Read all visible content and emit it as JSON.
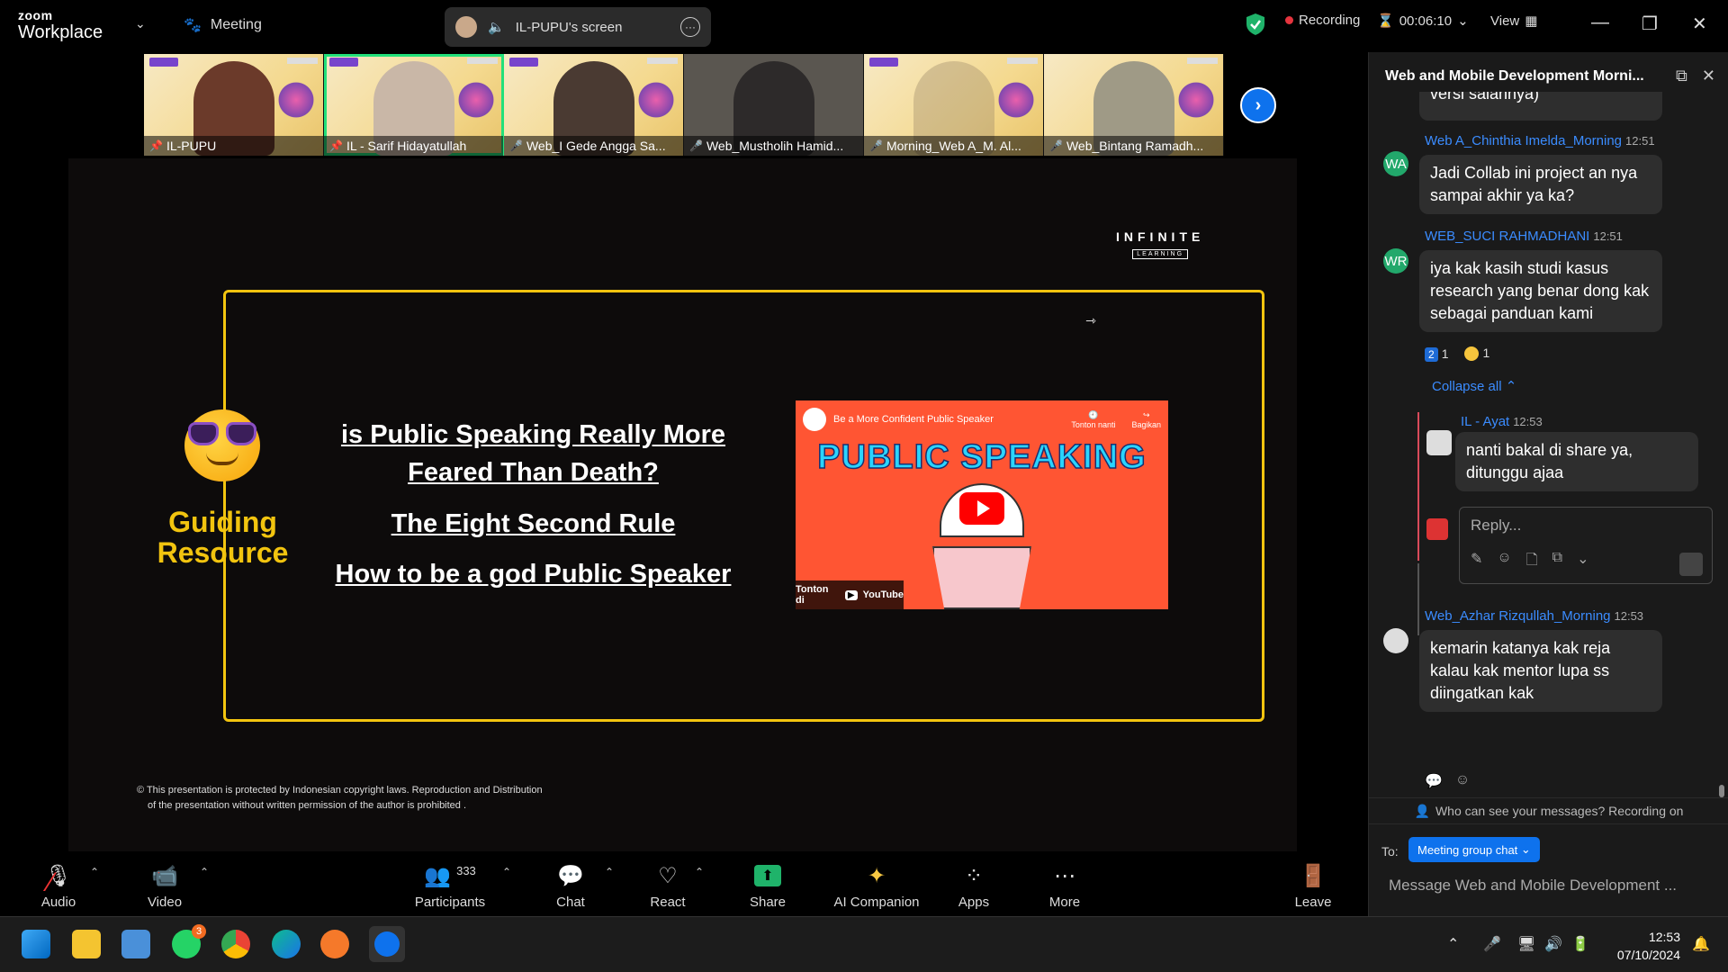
{
  "topbar": {
    "brand_small": "zoom",
    "brand_big": "Workplace",
    "meeting_label": "Meeting",
    "screen_label": "IL-PUPU's screen",
    "recording_label": "Recording",
    "timer": "00:06:10",
    "view_label": "View"
  },
  "gallery": {
    "participants": [
      {
        "name": "IL-PUPU",
        "skin": "#6b3a2a"
      },
      {
        "name": "IL - Sarif Hidayatullah",
        "skin": "#c9b7a7"
      },
      {
        "name": "Web_I Gede Angga Sa...",
        "skin": "#4a3a32"
      },
      {
        "name": "Web_Mustholih Hamid...",
        "skin": "#2d2a2a"
      },
      {
        "name": "Morning_Web A_M. Al...",
        "skin": "#a08c6b"
      },
      {
        "name": "Web_Bintang Ramadh...",
        "skin": "#9f9a86"
      }
    ]
  },
  "slide": {
    "brand": "INFINITE",
    "brand_sub": "LEARNING",
    "guiding": "Guiding Resource",
    "link1": "is Public Speaking Really More Feared Than Death?",
    "link2": "The Eight Second Rule",
    "link3": "How to be a god Public Speaker",
    "video_title": "Be a More Confident Public Speaker",
    "video_watch_later": "Tonton nanti",
    "video_share": "Bagikan",
    "video_big": "PUBLIC SPEAKING",
    "video_watch_on": "Tonton di",
    "video_yt": "YouTube",
    "copyright_1": "© This presentation is protected by Indonesian copyright laws. Reproduction and Distribution",
    "copyright_2": "of the presentation without written permission of the author is prohibited ."
  },
  "chat": {
    "title": "Web and Mobile Development Morni...",
    "partial_msg": "versi salahnya)",
    "messages": [
      {
        "name": "Web A_Chinthia Imelda_Morning",
        "time": "12:51",
        "initials": "WA",
        "text": "Jadi Collab ini project an nya sampai akhir ya ka?"
      },
      {
        "name": "WEB_SUCI RAHMADHANI",
        "time": "12:51",
        "initials": "WR",
        "text": "iya kak kasih studi kasus research yang benar dong kak sebagai panduan kami"
      },
      {
        "name": "IL - Ayat",
        "time": "12:53",
        "text": "nanti bakal di share ya, ditunggu ajaa"
      },
      {
        "name": "Web_Azhar Rizqullah_Morning",
        "time": "12:53",
        "text": "kemarin katanya kak reja kalau kak mentor lupa ss diingatkan kak"
      }
    ],
    "reaction1_count": "1",
    "reaction1_badge": "2",
    "reaction2_count": "1",
    "collapse_label": "Collapse all",
    "reply_placeholder": "Reply...",
    "who_label": "Who can see your messages? Recording on",
    "to_label": "To:",
    "to_value": "Meeting group chat",
    "message_placeholder": "Message Web and Mobile Development ..."
  },
  "toolbar": {
    "audio": "Audio",
    "video": "Video",
    "participants": "Participants",
    "participants_count": "333",
    "chat": "Chat",
    "react": "React",
    "share": "Share",
    "ai": "AI Companion",
    "apps": "Apps",
    "more": "More",
    "leave": "Leave"
  },
  "taskbar": {
    "whatsapp_badge": "3",
    "time": "12:53",
    "date": "07/10/2024"
  },
  "colors": {
    "accent": "#0e72ed",
    "frame": "#f2c40f",
    "active_tile": "#22e07a",
    "recording": "#e5343e"
  }
}
